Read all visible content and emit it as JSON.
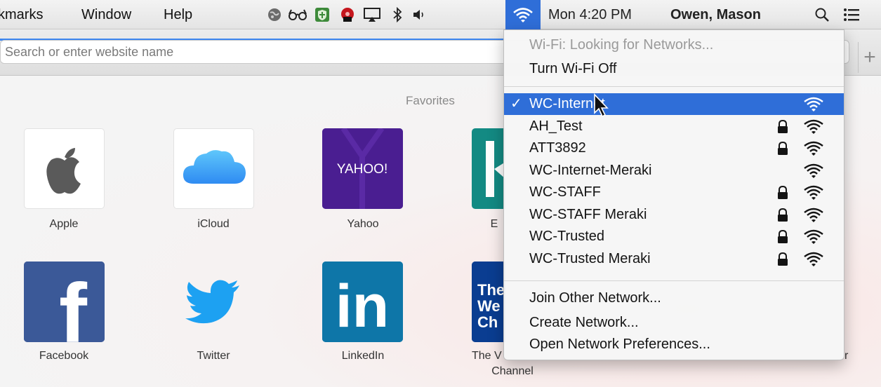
{
  "menubar": {
    "items": [
      "kmarks",
      "Window",
      "Help"
    ],
    "clock": "Mon 4:20 PM",
    "user": "Owen, Mason",
    "icons": [
      "globe-icon",
      "glasses-icon",
      "shield-icon",
      "antivirus-icon",
      "airplay-icon",
      "bluetooth-icon",
      "volume-icon",
      "wifi-icon",
      "spotlight-icon",
      "notification-center-icon"
    ]
  },
  "browser": {
    "search_placeholder": "Search or enter website name",
    "new_tab": "+"
  },
  "favorites": {
    "heading": "Favorites",
    "row1": [
      {
        "label": "Apple",
        "icon": "apple-icon"
      },
      {
        "label": "iCloud",
        "icon": "icloud-icon"
      },
      {
        "label": "Yahoo",
        "icon": "yahoo-icon",
        "logo_text": "YAHOO!"
      },
      {
        "label": "E",
        "icon": "bing-icon"
      }
    ],
    "row2": [
      {
        "label": "Facebook",
        "icon": "facebook-icon",
        "logo_text": "f"
      },
      {
        "label": "Twitter",
        "icon": "twitter-icon"
      },
      {
        "label": "LinkedIn",
        "icon": "linkedin-icon",
        "logo_text": "in"
      },
      {
        "label": "The V",
        "label2": "Channel",
        "icon": "weather-channel-icon",
        "logo_lines": [
          "The",
          "We",
          "Ch"
        ]
      }
    ],
    "right_edge_text": "r"
  },
  "wifi_menu": {
    "status": "Wi-Fi: Looking for Networks...",
    "toggle": "Turn Wi-Fi Off",
    "networks": [
      {
        "name": "WC-Internet",
        "selected": true,
        "locked": false
      },
      {
        "name": "AH_Test",
        "selected": false,
        "locked": true
      },
      {
        "name": "ATT3892",
        "selected": false,
        "locked": true
      },
      {
        "name": "WC-Internet-Meraki",
        "selected": false,
        "locked": false
      },
      {
        "name": "WC-STAFF",
        "selected": false,
        "locked": true
      },
      {
        "name": "WC-STAFF Meraki",
        "selected": false,
        "locked": true
      },
      {
        "name": "WC-Trusted",
        "selected": false,
        "locked": true
      },
      {
        "name": "WC-Trusted Meraki",
        "selected": false,
        "locked": true
      }
    ],
    "check_mark": "✓",
    "actions": [
      "Join Other Network...",
      "Create Network...",
      "Open Network Preferences..."
    ]
  },
  "colors": {
    "selection": "#2f6ed8",
    "yahoo": "#4a1e91",
    "facebook": "#3b5998",
    "linkedin": "#0e76a8",
    "twitter": "#1da1f2",
    "weather_channel": "#0a3d91",
    "bing": "#138a83"
  }
}
